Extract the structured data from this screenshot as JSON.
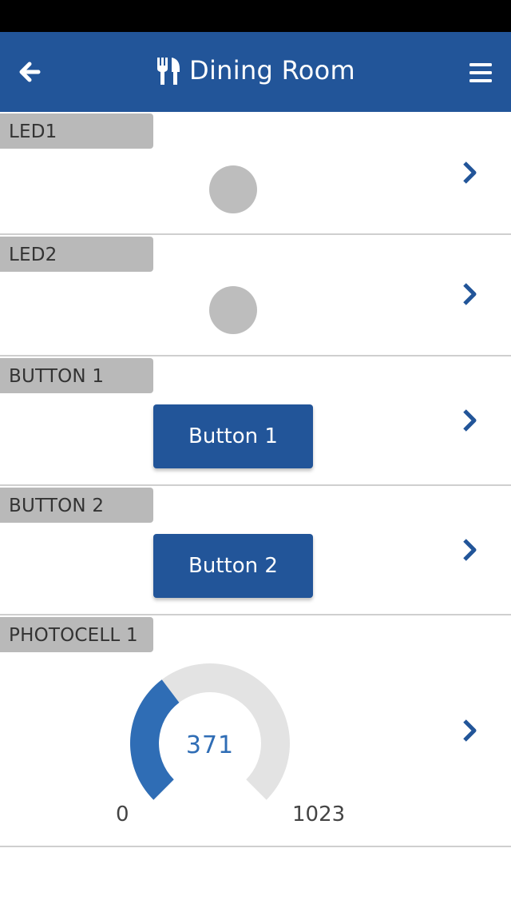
{
  "header": {
    "title": "Dining Room",
    "title_icon": "fork-knife-icon",
    "back_icon": "arrow-left-icon",
    "menu_icon": "hamburger-menu-icon"
  },
  "colors": {
    "accent": "#225599",
    "gauge_fill": "#2f6db5",
    "gauge_track": "#e3e3e3",
    "led_off": "#bdbdbd",
    "label_bg": "#b9b9b9"
  },
  "panels": [
    {
      "label": "LED1",
      "type": "led",
      "state": "off"
    },
    {
      "label": "LED2",
      "type": "led",
      "state": "off"
    },
    {
      "label": "BUTTON 1",
      "type": "button",
      "button_label": "Button 1"
    },
    {
      "label": "BUTTON 2",
      "type": "button",
      "button_label": "Button 2"
    },
    {
      "label": "PHOTOCELL 1",
      "type": "gauge",
      "gauge": {
        "value": 371,
        "value_text": "371",
        "min": 0,
        "min_text": "0",
        "max": 1023,
        "max_text": "1023"
      }
    }
  ]
}
